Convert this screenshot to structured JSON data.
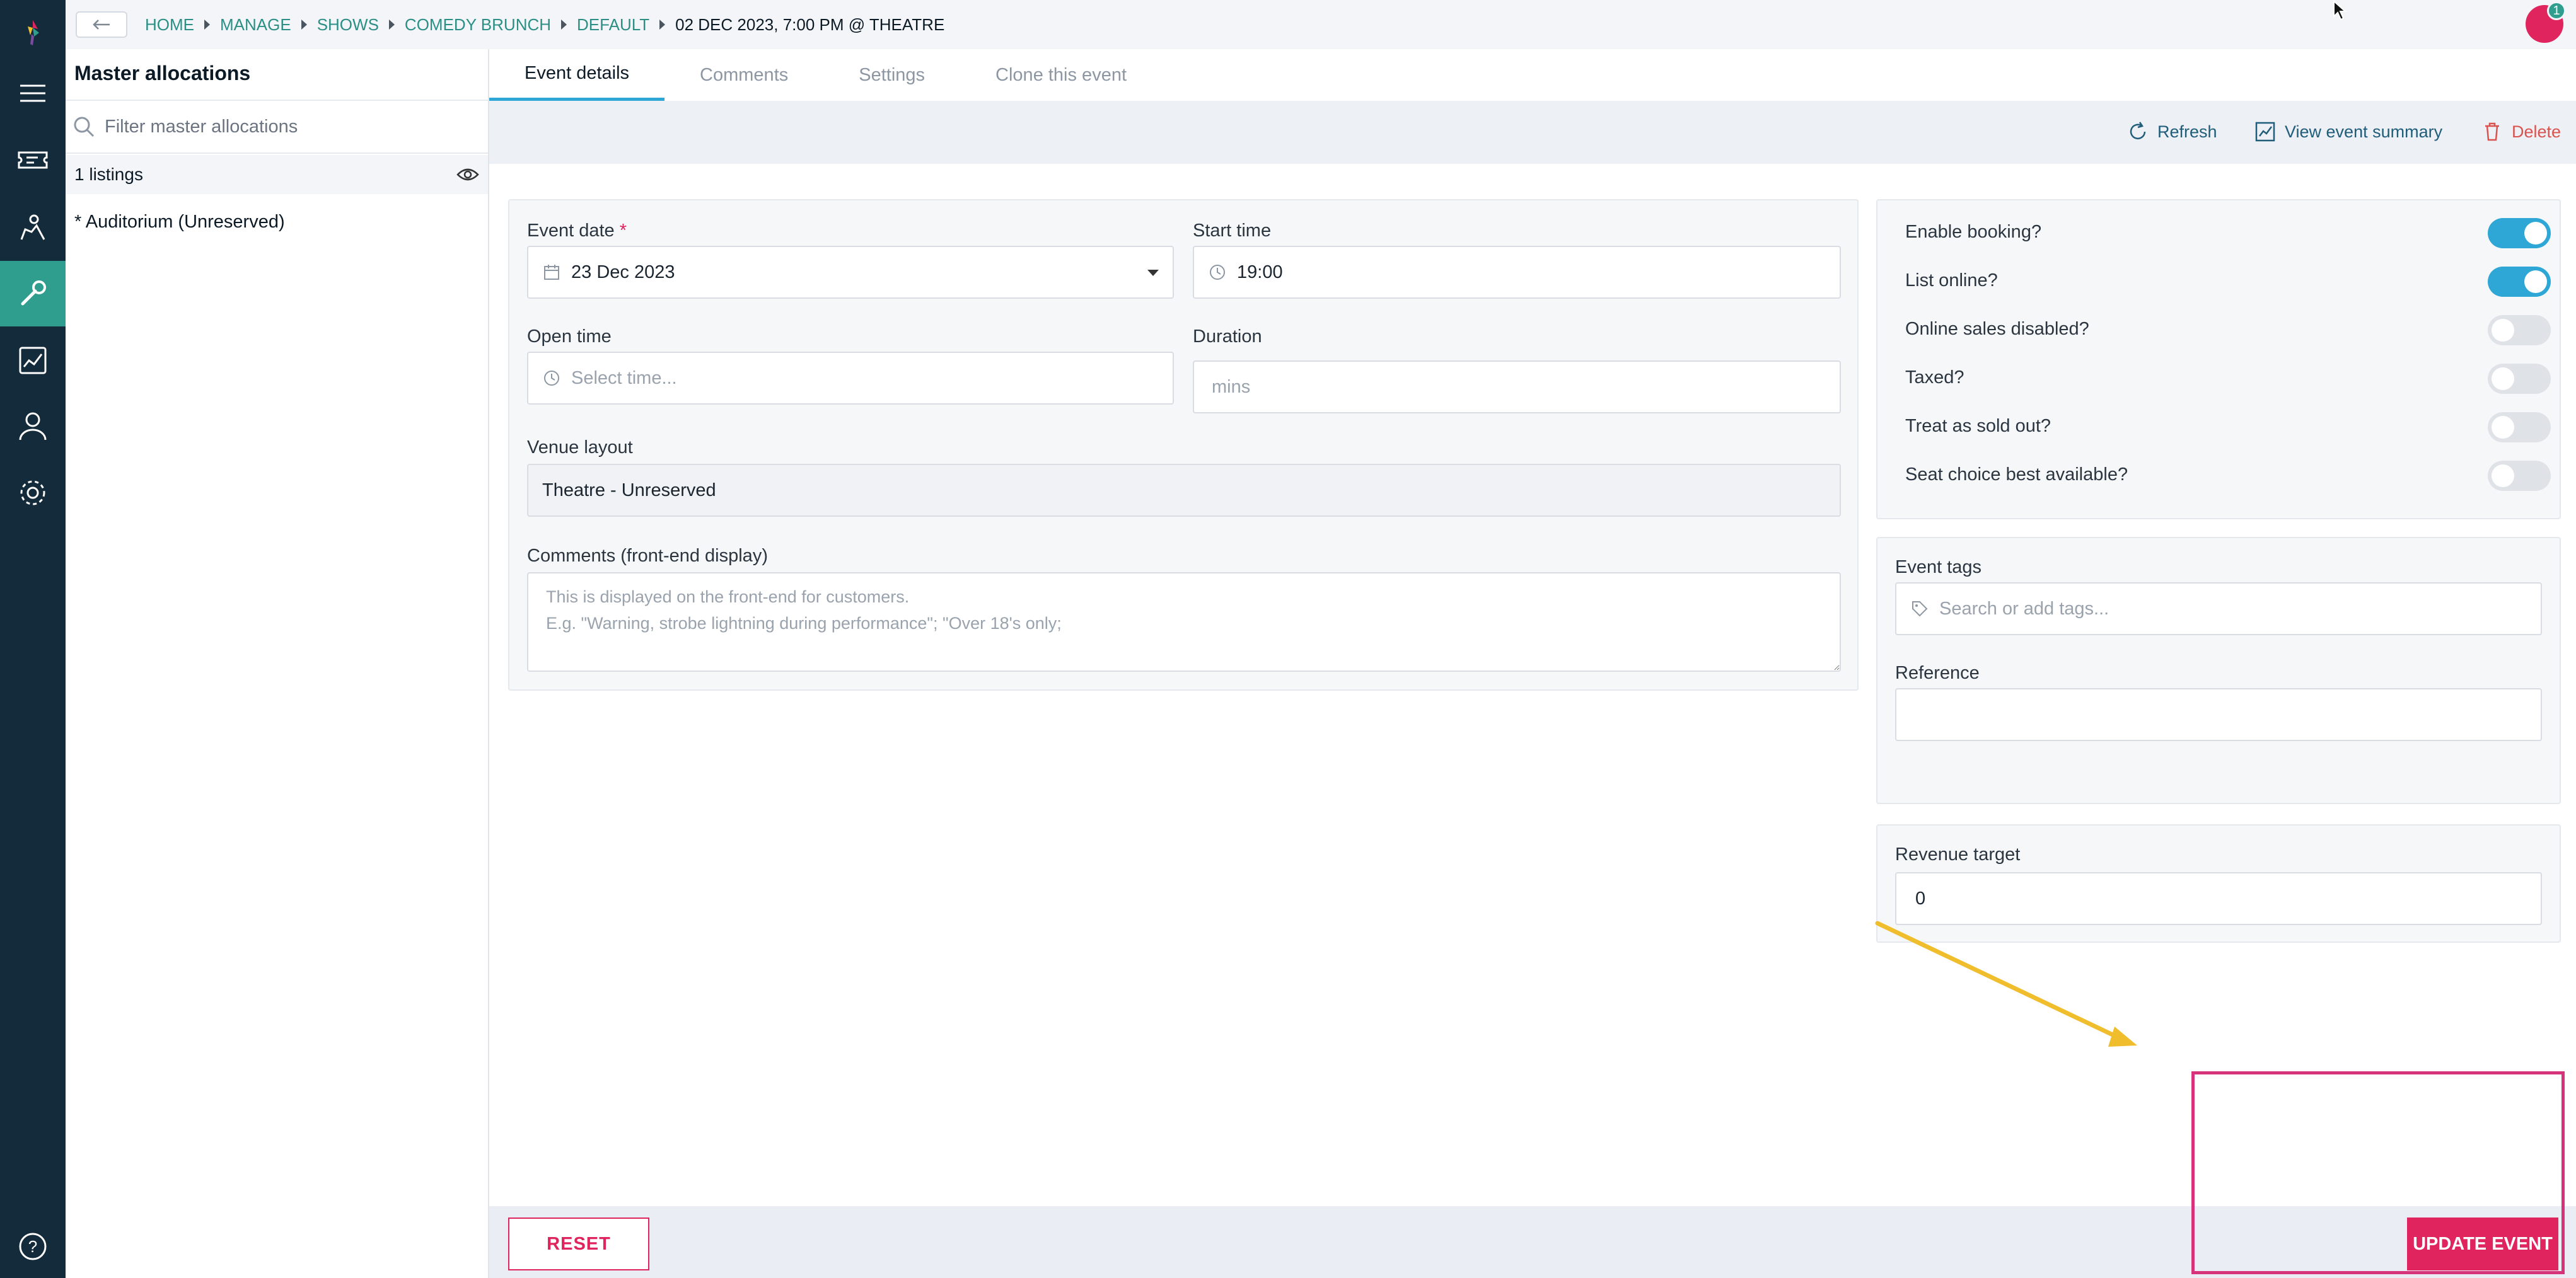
{
  "breadcrumbs": [
    "HOME",
    "MANAGE",
    "SHOWS",
    "COMEDY BRUNCH",
    "DEFAULT",
    "02 DEC 2023, 7:00 PM @ THEATRE"
  ],
  "notification_count": "1",
  "allocations": {
    "title": "Master allocations",
    "filter_placeholder": "Filter master allocations",
    "count_label": "1 listings",
    "items": [
      "* Auditorium (Unreserved)"
    ]
  },
  "tabs": [
    "Event details",
    "Comments",
    "Settings",
    "Clone this event"
  ],
  "actions": {
    "refresh": "Refresh",
    "summary": "View event summary",
    "delete": "Delete"
  },
  "form": {
    "event_date_label": "Event date",
    "required_mark": "*",
    "event_date_value": "23 Dec 2023",
    "start_time_label": "Start time",
    "start_time_value": "19:00",
    "open_time_label": "Open time",
    "open_time_placeholder": "Select time...",
    "duration_label": "Duration",
    "duration_placeholder": "mins",
    "venue_layout_label": "Venue layout",
    "venue_layout_value": "Theatre - Unreserved",
    "comments_label": "Comments (front-end display)",
    "comments_placeholder": "This is displayed on the front-end for customers.\nE.g. \"Warning, strobe lightning during performance\"; \"Over 18's only;"
  },
  "toggles": [
    {
      "label": "Enable booking?",
      "on": true
    },
    {
      "label": "List online?",
      "on": true
    },
    {
      "label": "Online sales disabled?",
      "on": false
    },
    {
      "label": "Taxed?",
      "on": false
    },
    {
      "label": "Treat as sold out?",
      "on": false
    },
    {
      "label": "Seat choice best available?",
      "on": false
    }
  ],
  "tags": {
    "label": "Event tags",
    "placeholder": "Search or add tags..."
  },
  "reference": {
    "label": "Reference",
    "value": ""
  },
  "revenue": {
    "label": "Revenue target",
    "value": "0"
  },
  "buttons": {
    "reset": "RESET",
    "update": "UPDATE EVENT"
  },
  "colors": {
    "rail": "#132b3a",
    "accent_teal": "#2f9e8f",
    "toggle_on": "#2ea7d6",
    "primary_pink": "#e0245e",
    "annotation_arrow": "#f0bd2c"
  }
}
